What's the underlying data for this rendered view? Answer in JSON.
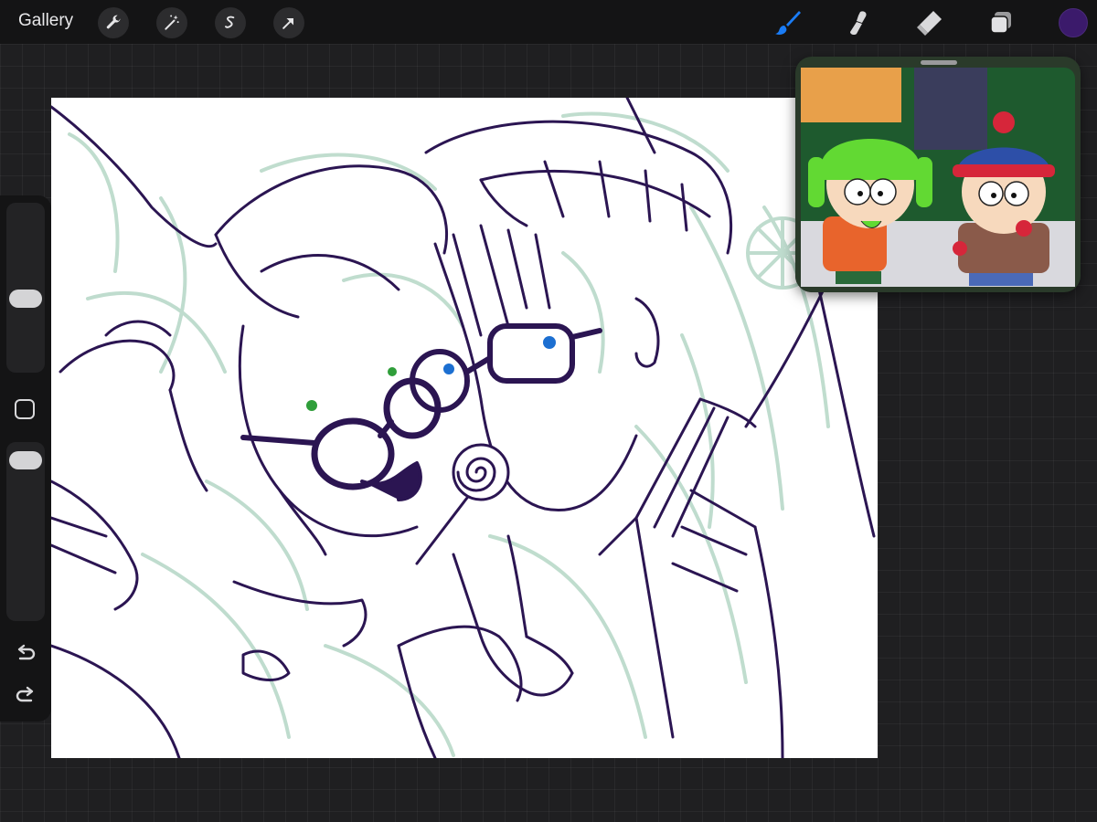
{
  "toolbar": {
    "gallery_label": "Gallery",
    "left_tools": [
      "wrench-icon",
      "magic-wand-icon",
      "selection-icon",
      "transform-arrow-icon"
    ],
    "right_tools": [
      "brush-icon",
      "smudge-icon",
      "eraser-icon",
      "layers-icon"
    ],
    "active_tool": "brush-icon",
    "current_color": "#3b1a6b",
    "accent_color": "#1a7cf5"
  },
  "sidebar": {
    "brush_size_level": 0.52,
    "opacity_level": 0.1,
    "items": [
      "brush-size-slider",
      "modify-button",
      "opacity-slider",
      "undo-icon",
      "redo-icon"
    ]
  },
  "canvas": {
    "line_color": "#2b1552",
    "sketch_color": "#b9d9c9",
    "eye_colors": [
      "#2f9e3a",
      "#1c6fd1"
    ]
  },
  "reference": {
    "subject": "reference-image-two-cartoon-boys-winter-hats",
    "colors": [
      "#62d933",
      "#e8642c",
      "#2d4fa8",
      "#d6263a"
    ]
  }
}
